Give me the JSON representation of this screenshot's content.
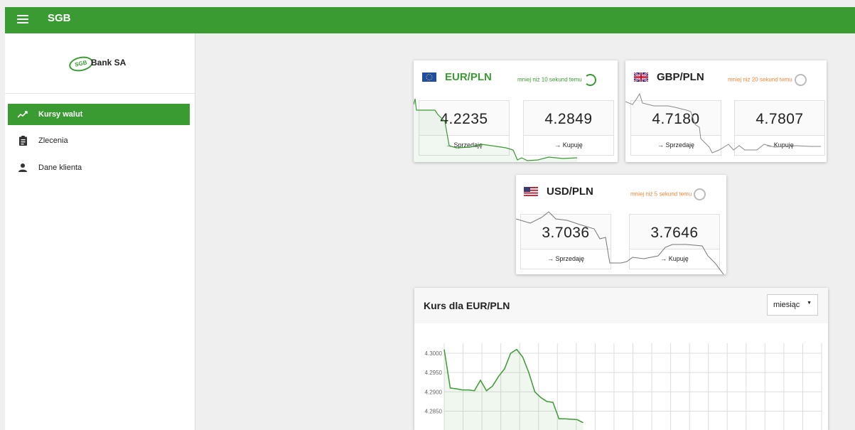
{
  "app": {
    "title": "SGB"
  },
  "sidebar": {
    "logo_mark": "SGB",
    "logo_text": "Bank SA",
    "items": [
      {
        "label": "Kursy walut",
        "icon": "trending-up-icon",
        "active": true
      },
      {
        "label": "Zlecenia",
        "icon": "clipboard-icon",
        "active": false
      },
      {
        "label": "Dane klienta",
        "icon": "person-icon",
        "active": false
      }
    ]
  },
  "rates": [
    {
      "pair": "EUR/PLN",
      "status": "mniej niż 10 sekund temu",
      "status_color": "#3a9b32",
      "sell": "4.2235",
      "buy": "4.2849",
      "sell_label": "→ Sprzedaję",
      "buy_label": "→ Kupuję"
    },
    {
      "pair": "GBP/PLN",
      "status": "mniej niż 20 sekund temu",
      "status_color": "#f0883a",
      "sell": "4.7180",
      "buy": "4.7807",
      "sell_label": "→ Sprzedaję",
      "buy_label": "→ Kupuję"
    },
    {
      "pair": "USD/PLN",
      "status": "mniej niż 5 sekund temu",
      "status_color": "#f0883a",
      "sell": "3.7036",
      "buy": "3.7646",
      "sell_label": "→ Sprzedaję",
      "buy_label": "→ Kupuję"
    }
  ],
  "chart": {
    "title": "Kurs dla EUR/PLN",
    "period": "miesiąc",
    "accent": "#3a9b32"
  },
  "chart_data": {
    "type": "line",
    "title": "Kurs dla EUR/PLN",
    "xlabel": "",
    "ylabel": "",
    "yticks": [
      "4.3000",
      "4.2950",
      "4.2900",
      "4.2850"
    ],
    "ylim": [
      4.279,
      4.301
    ],
    "series": [
      {
        "values": [
          4.301,
          4.291,
          4.2908,
          4.2905,
          4.2905,
          4.2903,
          4.293,
          4.2903,
          4.2915,
          4.294,
          4.296,
          4.3,
          4.301,
          4.299,
          4.295,
          4.29,
          4.2885,
          4.2875,
          4.2873,
          4.283,
          4.283,
          4.2829,
          4.2828,
          4.282
        ]
      }
    ]
  }
}
